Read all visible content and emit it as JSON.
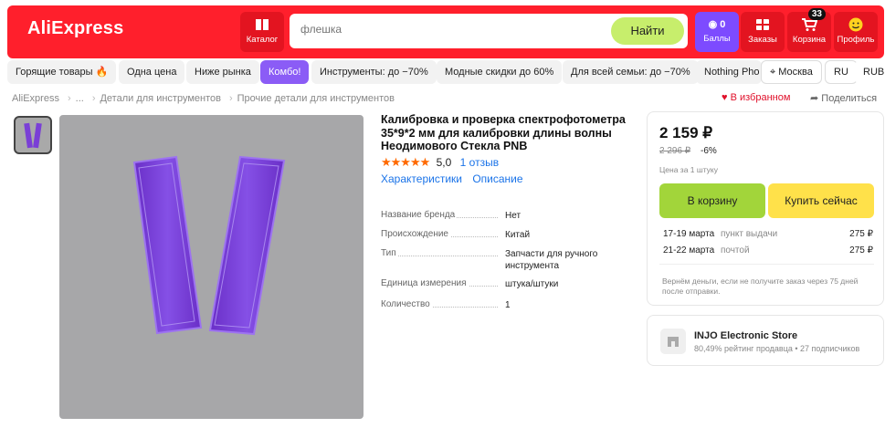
{
  "header": {
    "logo": "AliExpress",
    "catalog_label": "Каталог",
    "search_placeholder": "флешка",
    "search_button": "Найти",
    "bonus_count": "0",
    "bonus_label": "Баллы",
    "orders_label": "Заказы",
    "cart_label": "Корзина",
    "cart_badge": "33",
    "profile_label": "Профиль"
  },
  "chips": [
    "Горящие товары 🔥",
    "Одна цена",
    "Ниже рынка",
    "Комбо!",
    "Инструменты: до −70%",
    "Модные скидки до 60%",
    "Для всей семьи: до −70%",
    "Nothing Pho"
  ],
  "locale": {
    "city": "Москва",
    "language": "RU",
    "currency": "RUB"
  },
  "breadcrumb": [
    "AliExpress",
    "...",
    "Детали для инструментов",
    "Прочие детали для инструментов"
  ],
  "actions": {
    "favorite": "В избранном",
    "share": "Поделиться"
  },
  "product": {
    "title": "Калибровка и проверка спектрофотометра 35*9*2 мм для калибровки длины волны Неодимового Стекла PNB",
    "stars": "★★★★★",
    "rating": "5,0",
    "reviews": "1 отзыв",
    "tabs": [
      "Характеристики",
      "Описание"
    ],
    "specs": [
      {
        "key": "Название бренда",
        "value": "Нет"
      },
      {
        "key": "Происхождение",
        "value": "Китай"
      },
      {
        "key": "Тип",
        "value": "Запчасти для ручного инструмента"
      },
      {
        "key": "Единица измерения",
        "value": "штука/штуки"
      },
      {
        "key": "Количество",
        "value": "1"
      }
    ]
  },
  "buybox": {
    "price": "2 159 ₽",
    "old_price": "2 296 ₽",
    "discount": "-6%",
    "unit_note": "Цена за 1 штуку",
    "cart_button": "В корзину",
    "buy_button": "Купить сейчас",
    "delivery": [
      {
        "dates": "17-19 марта",
        "method": "пункт выдачи",
        "price": "275 ₽"
      },
      {
        "dates": "21-22 марта",
        "method": "почтой",
        "price": "275 ₽"
      }
    ],
    "note": "Вернём деньги, если не получите заказ через 75 дней после отправки."
  },
  "store": {
    "name": "INJO Electronic Store",
    "rating": "80,49% рейтинг продавца",
    "subscribers": "27 подписчиков"
  },
  "colors": {
    "brand_red": "#ff1f2c",
    "accent_purple": "#8b5cf6",
    "cart_green": "#a2d53a",
    "buy_yellow": "#ffe14a",
    "link_blue": "#1a73e8"
  }
}
